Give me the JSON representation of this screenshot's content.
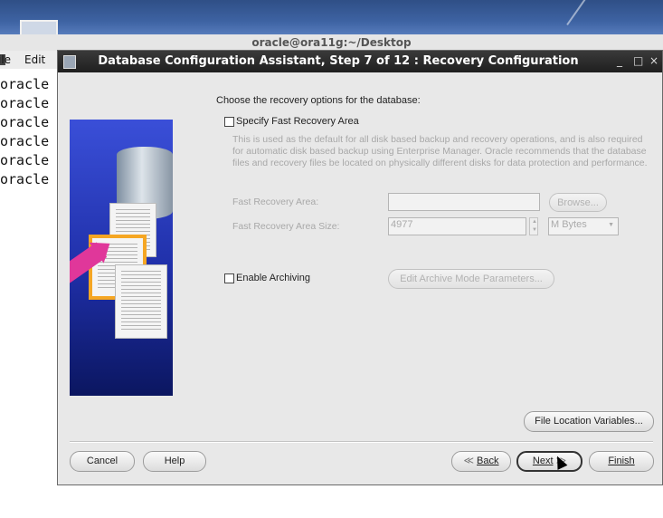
{
  "terminal": {
    "title": "oracle@ora11g:~/Desktop",
    "menu": [
      "ile",
      "Edit"
    ],
    "lines": [
      "oracle",
      "oracle",
      "oracle",
      "oracle",
      "oracle",
      "oracle"
    ]
  },
  "dialog": {
    "title": "Database Configuration Assistant, Step 7 of 12 : Recovery Configuration",
    "window_controls": [
      "_",
      "□",
      "×"
    ],
    "prompt": "Choose the recovery options for the database:",
    "fast_recovery": {
      "checkbox_label": "Specify Fast Recovery Area",
      "checked": false,
      "description": "This is used as the default for all disk based backup and recovery operations, and is also required for automatic disk based backup using Enterprise Manager. Oracle recommends that the database files and recovery files be located on physically different disks for data protection and performance.",
      "area_label": "Fast Recovery Area:",
      "area_value": "",
      "browse_label": "Browse...",
      "size_label": "Fast Recovery Area Size:",
      "size_value": "4977",
      "size_unit": "M Bytes"
    },
    "archiving": {
      "checkbox_label": "Enable Archiving",
      "checked": false,
      "edit_button": "Edit Archive Mode Parameters..."
    },
    "file_location_button": "File Location Variables...",
    "buttons": {
      "cancel": "Cancel",
      "help": "Help",
      "back": "Back",
      "next": "Next",
      "finish": "Finish"
    }
  }
}
